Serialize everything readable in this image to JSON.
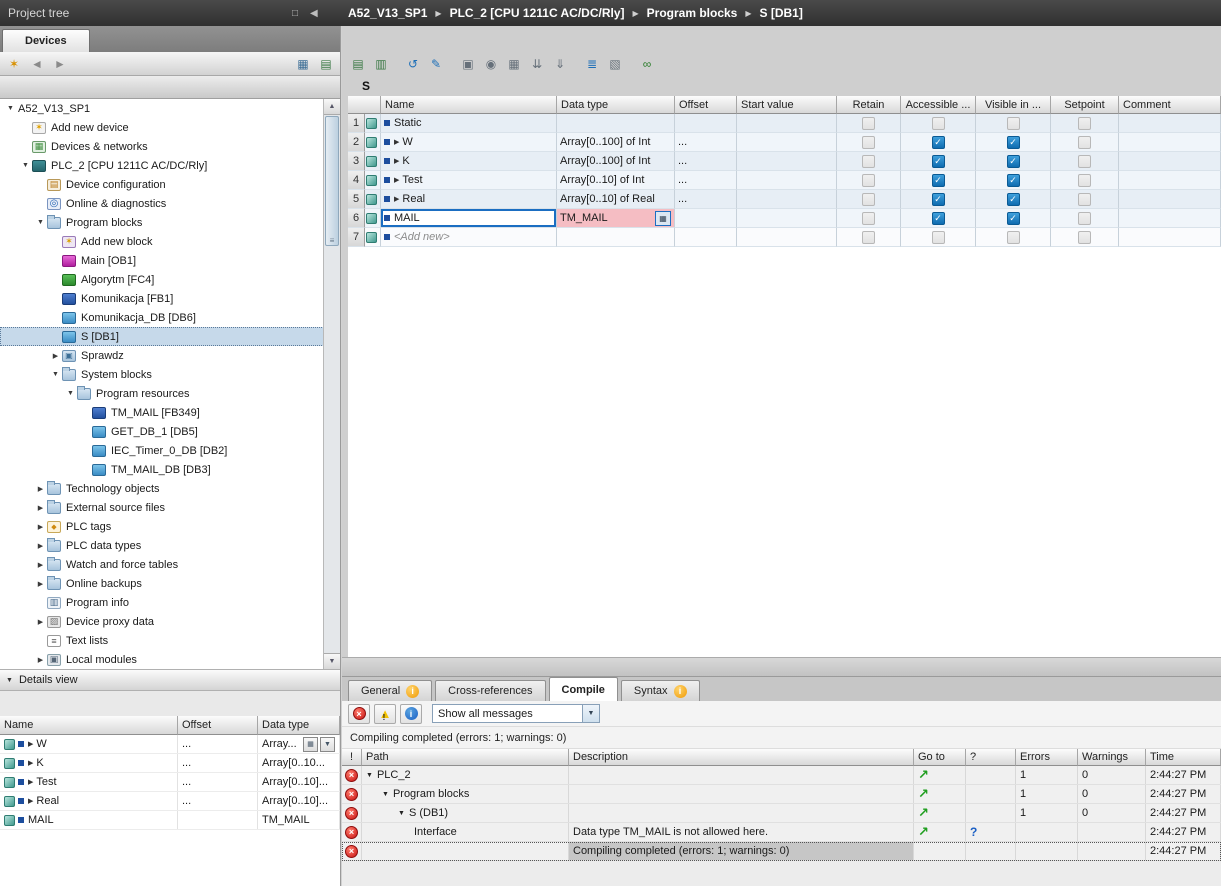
{
  "topbar": {
    "left_title": "Project tree",
    "window_icons": [
      {
        "name": "restore-panel-icon",
        "glyph": "□"
      },
      {
        "name": "collapse-panel-icon",
        "glyph": "◀"
      }
    ],
    "breadcrumb": [
      "A52_V13_SP1",
      "PLC_2 [CPU 1211C AC/DC/Rly]",
      "Program blocks",
      "S [DB1]"
    ]
  },
  "colors": {
    "accent_blue": "#1b6ec2",
    "error_red": "#c81414",
    "warning_yellow": "#f2c100",
    "checked_blue": "#0f6cb0",
    "datatype_error_pink": "#f5bdc3",
    "titlebar_dark": "#3a3a3a"
  },
  "project_tree": {
    "tab_label": "Devices",
    "toolbar_left": [
      {
        "name": "new-object-icon",
        "glyph": "✶",
        "color": "#d89000"
      },
      {
        "name": "navigate-back-icon",
        "glyph": "◄",
        "color": "#8a8a8a"
      },
      {
        "name": "navigate-forward-icon",
        "glyph": "►",
        "color": "#8a8a8a"
      }
    ],
    "toolbar_right": [
      {
        "name": "column-display-icon",
        "glyph": "▦",
        "color": "#3c6e96"
      },
      {
        "name": "export-module-icon",
        "glyph": "▤",
        "color": "#3c7a46"
      }
    ],
    "items": [
      {
        "label": "A52_V13_SP1",
        "level": 0,
        "expander": "open"
      },
      {
        "label": "Add new device",
        "level": 1,
        "icon": "add-new-device"
      },
      {
        "label": "Devices & networks",
        "level": 1,
        "icon": "devices-networks"
      },
      {
        "label": "PLC_2 [CPU 1211C AC/DC/Rly]",
        "level": 1,
        "expander": "open",
        "icon": "plc"
      },
      {
        "label": "Device configuration",
        "level": 2,
        "icon": "device-config"
      },
      {
        "label": "Online & diagnostics",
        "level": 2,
        "icon": "online-diagnostics"
      },
      {
        "label": "Program blocks",
        "level": 2,
        "expander": "open",
        "icon": "folder"
      },
      {
        "label": "Add new block",
        "level": 3,
        "icon": "add-new-block"
      },
      {
        "label": "Main [OB1]",
        "level": 3,
        "icon": "ob-block"
      },
      {
        "label": "Algorytm [FC4]",
        "level": 3,
        "icon": "fc-block"
      },
      {
        "label": "Komunikacja [FB1]",
        "level": 3,
        "icon": "fb-block"
      },
      {
        "label": "Komunikacja_DB [DB6]",
        "level": 3,
        "icon": "db-block"
      },
      {
        "label": "S [DB1]",
        "level": 3,
        "icon": "db-block",
        "selected": true
      },
      {
        "label": "Sprawdz",
        "level": 3,
        "expander": "closed",
        "icon": "group"
      },
      {
        "label": "System blocks",
        "level": 3,
        "expander": "open",
        "icon": "folder"
      },
      {
        "label": "Program resources",
        "level": 4,
        "expander": "open",
        "icon": "folder"
      },
      {
        "label": "TM_MAIL [FB349]",
        "level": 5,
        "icon": "fb-block"
      },
      {
        "label": "GET_DB_1 [DB5]",
        "level": 5,
        "icon": "db-block"
      },
      {
        "label": "IEC_Timer_0_DB [DB2]",
        "level": 5,
        "icon": "db-block"
      },
      {
        "label": "TM_MAIL_DB [DB3]",
        "level": 5,
        "icon": "db-block"
      },
      {
        "label": "Technology objects",
        "level": 2,
        "expander": "closed",
        "icon": "folder"
      },
      {
        "label": "External source files",
        "level": 2,
        "expander": "closed",
        "icon": "folder"
      },
      {
        "label": "PLC tags",
        "level": 2,
        "expander": "closed",
        "icon": "tags"
      },
      {
        "label": "PLC data types",
        "level": 2,
        "expander": "closed",
        "icon": "folder"
      },
      {
        "label": "Watch and force tables",
        "level": 2,
        "expander": "closed",
        "icon": "folder"
      },
      {
        "label": "Online backups",
        "level": 2,
        "expander": "closed",
        "icon": "folder"
      },
      {
        "label": "Program info",
        "level": 2,
        "icon": "program-info"
      },
      {
        "label": "Device proxy data",
        "level": 2,
        "expander": "closed",
        "icon": "proxy"
      },
      {
        "label": "Text lists",
        "level": 2,
        "icon": "text-lists"
      },
      {
        "label": "Local modules",
        "level": 2,
        "expander": "closed",
        "icon": "modules"
      }
    ]
  },
  "details_view": {
    "title": "Details view",
    "columns": [
      "Name",
      "Offset",
      "Data type"
    ],
    "rows": [
      {
        "name": "W",
        "offset": "...",
        "type": "Array...",
        "expander": true,
        "buttons": true
      },
      {
        "name": "K",
        "offset": "...",
        "type": "Array[0..10...",
        "expander": true
      },
      {
        "name": "Test",
        "offset": "...",
        "type": "Array[0..10]...",
        "expander": true
      },
      {
        "name": "Real",
        "offset": "...",
        "type": "Array[0..10]...",
        "expander": true
      },
      {
        "name": "MAIL",
        "offset": "",
        "type": "TM_MAIL"
      }
    ]
  },
  "editor": {
    "title": "S",
    "toolbar_icons": [
      {
        "name": "insert-row-icon",
        "glyph": "▤",
        "color": "#3c7a46"
      },
      {
        "name": "add-row-icon",
        "glyph": "▥",
        "color": "#3c7a46"
      },
      {
        "name": "reset-start-values-icon",
        "glyph": "↺",
        "color": "#1d6fb8",
        "sep": true
      },
      {
        "name": "update-interface-icon",
        "glyph": "✎",
        "color": "#1d6fb8"
      },
      {
        "name": "keep-actual-values-icon",
        "glyph": "▣",
        "color": "#66707a",
        "sep": true
      },
      {
        "name": "snapshot-icon",
        "glyph": "◉",
        "color": "#66707a"
      },
      {
        "name": "copy-snapshots-icon",
        "glyph": "▦",
        "color": "#66707a"
      },
      {
        "name": "copy-to-start-values-icon",
        "glyph": "⇊",
        "color": "#66707a"
      },
      {
        "name": "load-start-values-icon",
        "glyph": "⇓",
        "color": "#66707a"
      },
      {
        "name": "expand-all-members-icon",
        "glyph": "≣",
        "color": "#1d6fb8",
        "sep": true
      },
      {
        "name": "settings-icon",
        "glyph": "▧",
        "color": "#66707a"
      },
      {
        "name": "monitor-all-icon",
        "glyph": "∞",
        "color": "#2b7d2b",
        "sep": true
      }
    ],
    "columns": [
      "Name",
      "Data type",
      "Offset",
      "Start value",
      "Retain",
      "Accessible ...",
      "Visible in ...",
      "Setpoint",
      "Comment"
    ],
    "rows": [
      {
        "num": "1",
        "name": "Static",
        "datatype": "",
        "offset": "",
        "start": "",
        "retain": "off",
        "accessible": "off",
        "visible": "off",
        "setpoint": "off"
      },
      {
        "num": "2",
        "name": "W",
        "expand": true,
        "datatype": "Array[0..100] of Int",
        "offset": "...",
        "start": "",
        "retain": "off",
        "accessible": "on",
        "visible": "on",
        "setpoint": "off"
      },
      {
        "num": "3",
        "name": "K",
        "expand": true,
        "datatype": "Array[0..100] of Int",
        "offset": "...",
        "start": "",
        "retain": "off",
        "accessible": "on",
        "visible": "on",
        "setpoint": "off"
      },
      {
        "num": "4",
        "name": "Test",
        "expand": true,
        "datatype": "Array[0..10] of Int",
        "offset": "...",
        "start": "",
        "retain": "off",
        "accessible": "on",
        "visible": "on",
        "setpoint": "off"
      },
      {
        "num": "5",
        "name": "Real",
        "expand": true,
        "datatype": "Array[0..10] of Real",
        "offset": "...",
        "start": "",
        "retain": "off",
        "accessible": "on",
        "visible": "on",
        "setpoint": "off"
      },
      {
        "num": "6",
        "name": "MAIL",
        "editing": true,
        "error": true,
        "datatype": "TM_MAIL",
        "offset": "",
        "start": "",
        "retain": "off",
        "accessible": "on",
        "visible": "on",
        "setpoint": "off"
      },
      {
        "num": "7",
        "name": "<Add new>",
        "placeholder": true,
        "datatype": "",
        "offset": "",
        "start": "",
        "retain": "off",
        "accessible": "off",
        "visible": "off",
        "setpoint": "off"
      }
    ]
  },
  "inspector": {
    "tabs": [
      {
        "label": "General",
        "info": true
      },
      {
        "label": "Cross-references"
      },
      {
        "label": "Compile",
        "active": true
      },
      {
        "label": "Syntax",
        "info": true
      }
    ],
    "filter_icons": [
      "errors-filter-icon",
      "warnings-filter-icon",
      "info-filter-icon"
    ],
    "filter_dropdown": "Show all messages",
    "status": "Compiling completed (errors: 1; warnings: 0)",
    "columns": [
      "!",
      "Path",
      "Description",
      "Go to",
      "?",
      "Errors",
      "Warnings",
      "Time"
    ],
    "rows": [
      {
        "path": "PLC_2",
        "level": 0,
        "expander": true,
        "goto": true,
        "errors": "1",
        "warnings": "0",
        "time": "2:44:27 PM"
      },
      {
        "path": "Program blocks",
        "level": 1,
        "expander": true,
        "goto": true,
        "errors": "1",
        "warnings": "0",
        "time": "2:44:27 PM"
      },
      {
        "path": "S (DB1)",
        "level": 2,
        "expander": true,
        "goto": true,
        "errors": "1",
        "warnings": "0",
        "time": "2:44:27 PM"
      },
      {
        "path": "Interface",
        "level": 3,
        "description": "Data type TM_MAIL is not allowed here.",
        "goto": true,
        "help": true,
        "time": "2:44:27 PM"
      },
      {
        "path": "",
        "description": "Compiling completed (errors: 1; warnings: 0)",
        "time": "2:44:27 PM",
        "selected": true
      }
    ]
  }
}
